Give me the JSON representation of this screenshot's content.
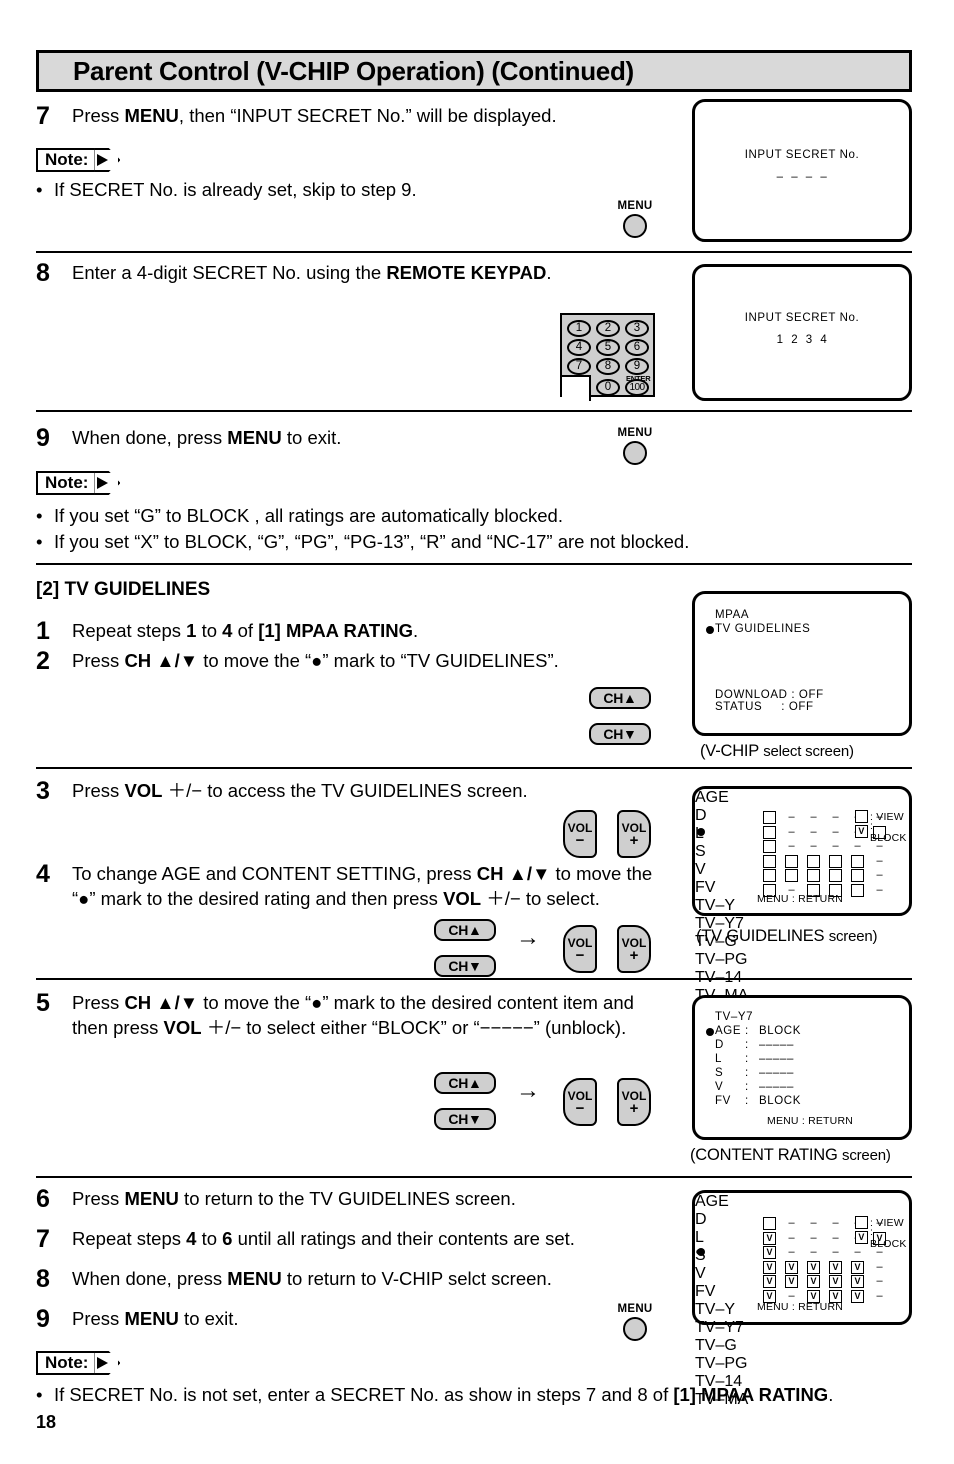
{
  "header": {
    "title": "Parent Control (V-CHIP Operation) (Continued)"
  },
  "page_number": "18",
  "labels": {
    "menu": "MENU",
    "ch_up": "CH▲",
    "ch_down": "CH▼",
    "vol_text": "VOL",
    "vol_minus": "−",
    "vol_plus": "+",
    "arrow": "→",
    "note": "Note:",
    "enter": "ENTER"
  },
  "keypad": {
    "keys": [
      "1",
      "2",
      "3",
      "4",
      "5",
      "6",
      "7",
      "8",
      "9",
      "0",
      "100"
    ]
  },
  "section_heading": "[2] TV GUIDELINES",
  "steps_top": [
    {
      "num": "7",
      "html": "Press <b>MENU</b>, then “INPUT SECRET No.” will be displayed."
    },
    {
      "num": "8",
      "html": "Enter a 4-digit SECRET No. using the <b>REMOTE KEYPAD</b>."
    },
    {
      "num": "9",
      "html": "When done, press <b>MENU</b> to exit."
    }
  ],
  "note1": {
    "bullets": [
      "If SECRET No. is already set, skip to step 9."
    ]
  },
  "note2": {
    "bullets": [
      "If you set “G” to BLOCK , all ratings are automatically blocked.",
      "If you set “X” to BLOCK, “G”, “PG”, “PG-13”, “R” and “NC-17” are not blocked."
    ]
  },
  "note3": {
    "bullets": [
      "If SECRET No. is not set, enter a SECRET No. as show in steps 7 and 8 of <b>[1] MPAA RATING</b>."
    ]
  },
  "steps_tv": [
    {
      "num": "1",
      "html": "Repeat steps <b>1</b> to <b>4</b> of <b>[1] MPAA RATING</b>."
    },
    {
      "num": "2",
      "html": "Press <b>CH ▲/▼</b> to move the “●” mark to “TV GUIDELINES”."
    },
    {
      "num": "3",
      "html": "Press <b>VOL</b> ＋/− to access the TV GUIDELINES screen."
    },
    {
      "num": "4",
      "html": "To change AGE and CONTENT SETTING, press <b>CH ▲/▼</b> to move the “●” mark to the desired rating and then press <b>VOL</b> ＋/− to select."
    },
    {
      "num": "5",
      "html": "Press <b>CH ▲/▼</b> to move the “●” mark to the desired content item and then press <b>VOL</b> ＋/− to select either “BLOCK” or “−−−−−” (unblock)."
    },
    {
      "num": "6",
      "html": "Press <b>MENU</b> to return to the TV GUIDELINES screen."
    },
    {
      "num": "7",
      "html": "Repeat steps <b>4</b> to <b>6</b> until all ratings and their contents are set."
    },
    {
      "num": "8",
      "html": "When done, press <b>MENU</b> to return to V-CHIP selct screen."
    },
    {
      "num": "9",
      "html": "Press <b>MENU</b> to exit."
    }
  ],
  "screens": {
    "secret_empty": {
      "title": "INPUT SECRET No.",
      "value": "–  –  –  –"
    },
    "secret_filled": {
      "title": "INPUT SECRET No.",
      "value": "1  2  3  4"
    },
    "vchip_select": {
      "items": [
        "MPAA",
        "TV GUIDELINES"
      ],
      "selected_index": 1,
      "download": "DOWNLOAD : OFF",
      "status": "STATUS     : OFF",
      "caption_main": "(V-CHIP",
      "caption_rest": "select  screen)"
    },
    "tv_guidelines": {
      "headers": [
        "AGE",
        "D",
        "L",
        "S",
        "V",
        "FV"
      ],
      "rows": [
        "TV–Y",
        "TV–Y7",
        "TV–G",
        "TV–PG",
        "TV–14",
        "TV–MA"
      ],
      "selected_row": 1,
      "age": [
        "box",
        "box",
        "box",
        "box",
        "box",
        "box"
      ],
      "d": [
        "dash",
        "dash",
        "dash",
        "box",
        "box",
        "dash"
      ],
      "l": [
        "dash",
        "dash",
        "dash",
        "box",
        "box",
        "box"
      ],
      "s": [
        "dash",
        "dash",
        "dash",
        "box",
        "box",
        "box"
      ],
      "v": [
        "dash",
        "dash",
        "dash",
        "box",
        "box",
        "box"
      ],
      "fv": [
        "dash",
        "box",
        "dash",
        "dash",
        "dash",
        "dash"
      ],
      "age_marks": [
        "",
        "",
        "",
        "",
        "",
        ""
      ],
      "d_marks": [
        "",
        "",
        "",
        "",
        "",
        ""
      ],
      "l_marks": [
        "",
        "",
        "",
        "",
        "",
        ""
      ],
      "s_marks": [
        "",
        "",
        "",
        "",
        "",
        ""
      ],
      "v_marks": [
        "",
        "",
        "",
        "",
        "",
        ""
      ],
      "fv_marks": [
        "",
        "",
        "",
        "",
        "",
        ""
      ],
      "legend_view": ": VIEW",
      "legend_block": ": BLOCK",
      "legend_block_mark": "V",
      "menu_return": "MENU : RETURN",
      "caption_main": "(TV  GUIDELINES",
      "caption_rest": "screen)"
    },
    "content_rating": {
      "title": "TV–Y7",
      "items": [
        {
          "name": "AGE",
          "sep": ":",
          "value": "BLOCK"
        },
        {
          "name": "D",
          "sep": ":",
          "value": "–––––"
        },
        {
          "name": "L",
          "sep": ":",
          "value": "–––––"
        },
        {
          "name": "S",
          "sep": ":",
          "value": "–––––"
        },
        {
          "name": "V",
          "sep": ":",
          "value": "–––––"
        },
        {
          "name": "FV",
          "sep": ":",
          "value": "BLOCK"
        }
      ],
      "selected_index": 0,
      "menu_return": "MENU : RETURN",
      "caption_main": "(CONTENT  RATING",
      "caption_rest": "screen)"
    },
    "tv_guidelines_set": {
      "headers": [
        "AGE",
        "D",
        "L",
        "S",
        "V",
        "FV"
      ],
      "rows": [
        "TV–Y",
        "TV–Y7",
        "TV–G",
        "TV–PG",
        "TV–14",
        "TV–MA"
      ],
      "selected_row": 2,
      "age": [
        "box",
        "box",
        "box",
        "box",
        "box",
        "box"
      ],
      "d": [
        "dash",
        "dash",
        "dash",
        "box",
        "box",
        "dash"
      ],
      "l": [
        "dash",
        "dash",
        "dash",
        "box",
        "box",
        "box"
      ],
      "s": [
        "dash",
        "dash",
        "dash",
        "box",
        "box",
        "box"
      ],
      "v": [
        "dash",
        "dash",
        "dash",
        "box",
        "box",
        "box"
      ],
      "fv": [
        "dash",
        "box",
        "dash",
        "dash",
        "dash",
        "dash"
      ],
      "age_marks": [
        "",
        "V",
        "V",
        "V",
        "V",
        "V"
      ],
      "d_marks": [
        "",
        "",
        "",
        "V",
        "V",
        ""
      ],
      "l_marks": [
        "",
        "",
        "",
        "V",
        "V",
        "V"
      ],
      "s_marks": [
        "",
        "",
        "",
        "V",
        "V",
        "V"
      ],
      "v_marks": [
        "",
        "",
        "",
        "V",
        "V",
        "V"
      ],
      "fv_marks": [
        "",
        "V",
        "",
        "",
        "",
        ""
      ],
      "legend_view": ": VIEW",
      "legend_block": ": BLOCK",
      "legend_block_mark": "V",
      "menu_return": "MENU : RETURN"
    }
  }
}
